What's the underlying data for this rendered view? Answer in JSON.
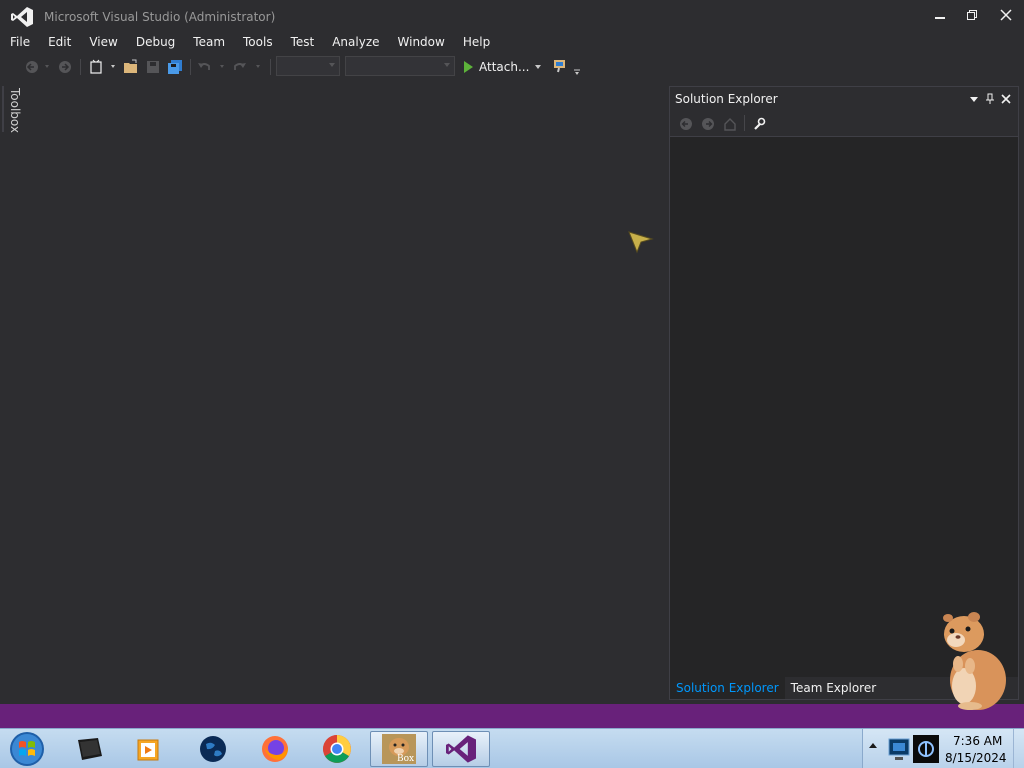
{
  "window": {
    "title": "Microsoft Visual Studio (Administrator)"
  },
  "menu": {
    "items": [
      "File",
      "Edit",
      "View",
      "Debug",
      "Team",
      "Tools",
      "Test",
      "Analyze",
      "Window",
      "Help"
    ]
  },
  "toolbar": {
    "attach_label": "Attach..."
  },
  "toolbox": {
    "label": "Toolbox"
  },
  "solution_explorer": {
    "title": "Solution Explorer",
    "tabs": [
      "Solution Explorer",
      "Team Explorer"
    ]
  },
  "taskbar": {
    "pinned": [
      "media-center-icon",
      "media-player-icon",
      "earth-icon",
      "firefox-icon",
      "chrome-icon",
      "hamster-box-icon",
      "visual-studio-icon"
    ],
    "hamster_box_label": "Box",
    "clock_time": "7:36 AM",
    "clock_date": "8/15/2024"
  },
  "colors": {
    "background": "#2d2d30",
    "panel": "#252526",
    "status_bar": "#68217a",
    "accent_blue": "#0097fb",
    "vs_purple": "#68217a"
  }
}
